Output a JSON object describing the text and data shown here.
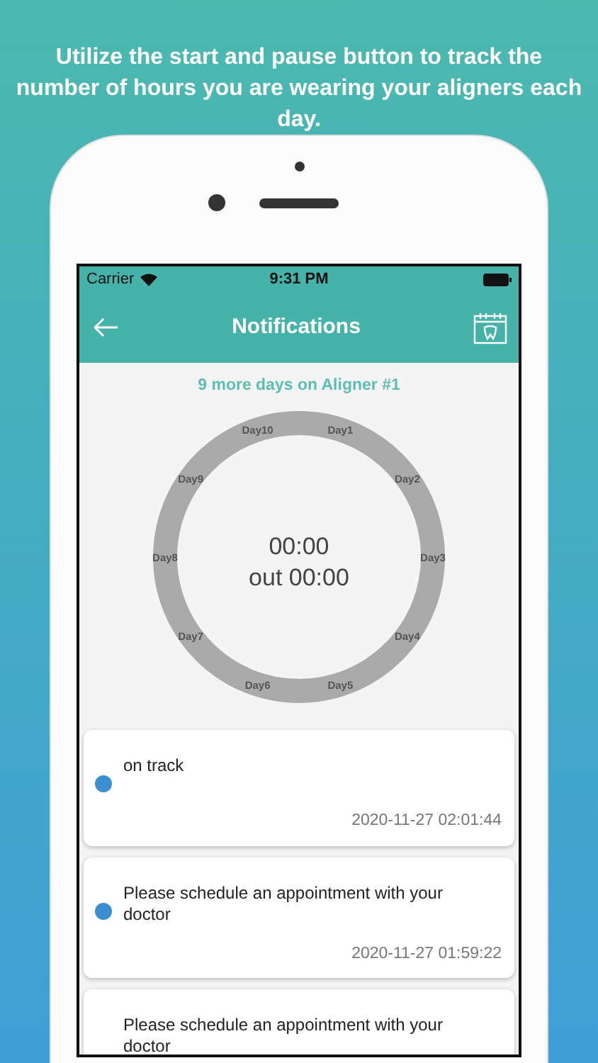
{
  "headline": "Utilize the start and pause button to track the number of hours you are wearing your aligners each day.",
  "status_bar": {
    "carrier": "Carrier",
    "time": "9:31 PM"
  },
  "nav": {
    "title": "Notifications"
  },
  "aligner_status": "9 more days on Aligner #1",
  "ring": {
    "days": [
      "Day1",
      "Day2",
      "Day3",
      "Day4",
      "Day5",
      "Day6",
      "Day7",
      "Day8",
      "Day9",
      "Day10"
    ],
    "time": "00:00",
    "out": "out 00:00"
  },
  "notifications": [
    {
      "message": "on track",
      "timestamp": "2020-11-27 02:01:44",
      "unread": true
    },
    {
      "message": "Please schedule an appointment with your doctor",
      "timestamp": "2020-11-27 01:59:22",
      "unread": true
    },
    {
      "message": "Please schedule an appointment with your doctor",
      "unread": false
    }
  ]
}
